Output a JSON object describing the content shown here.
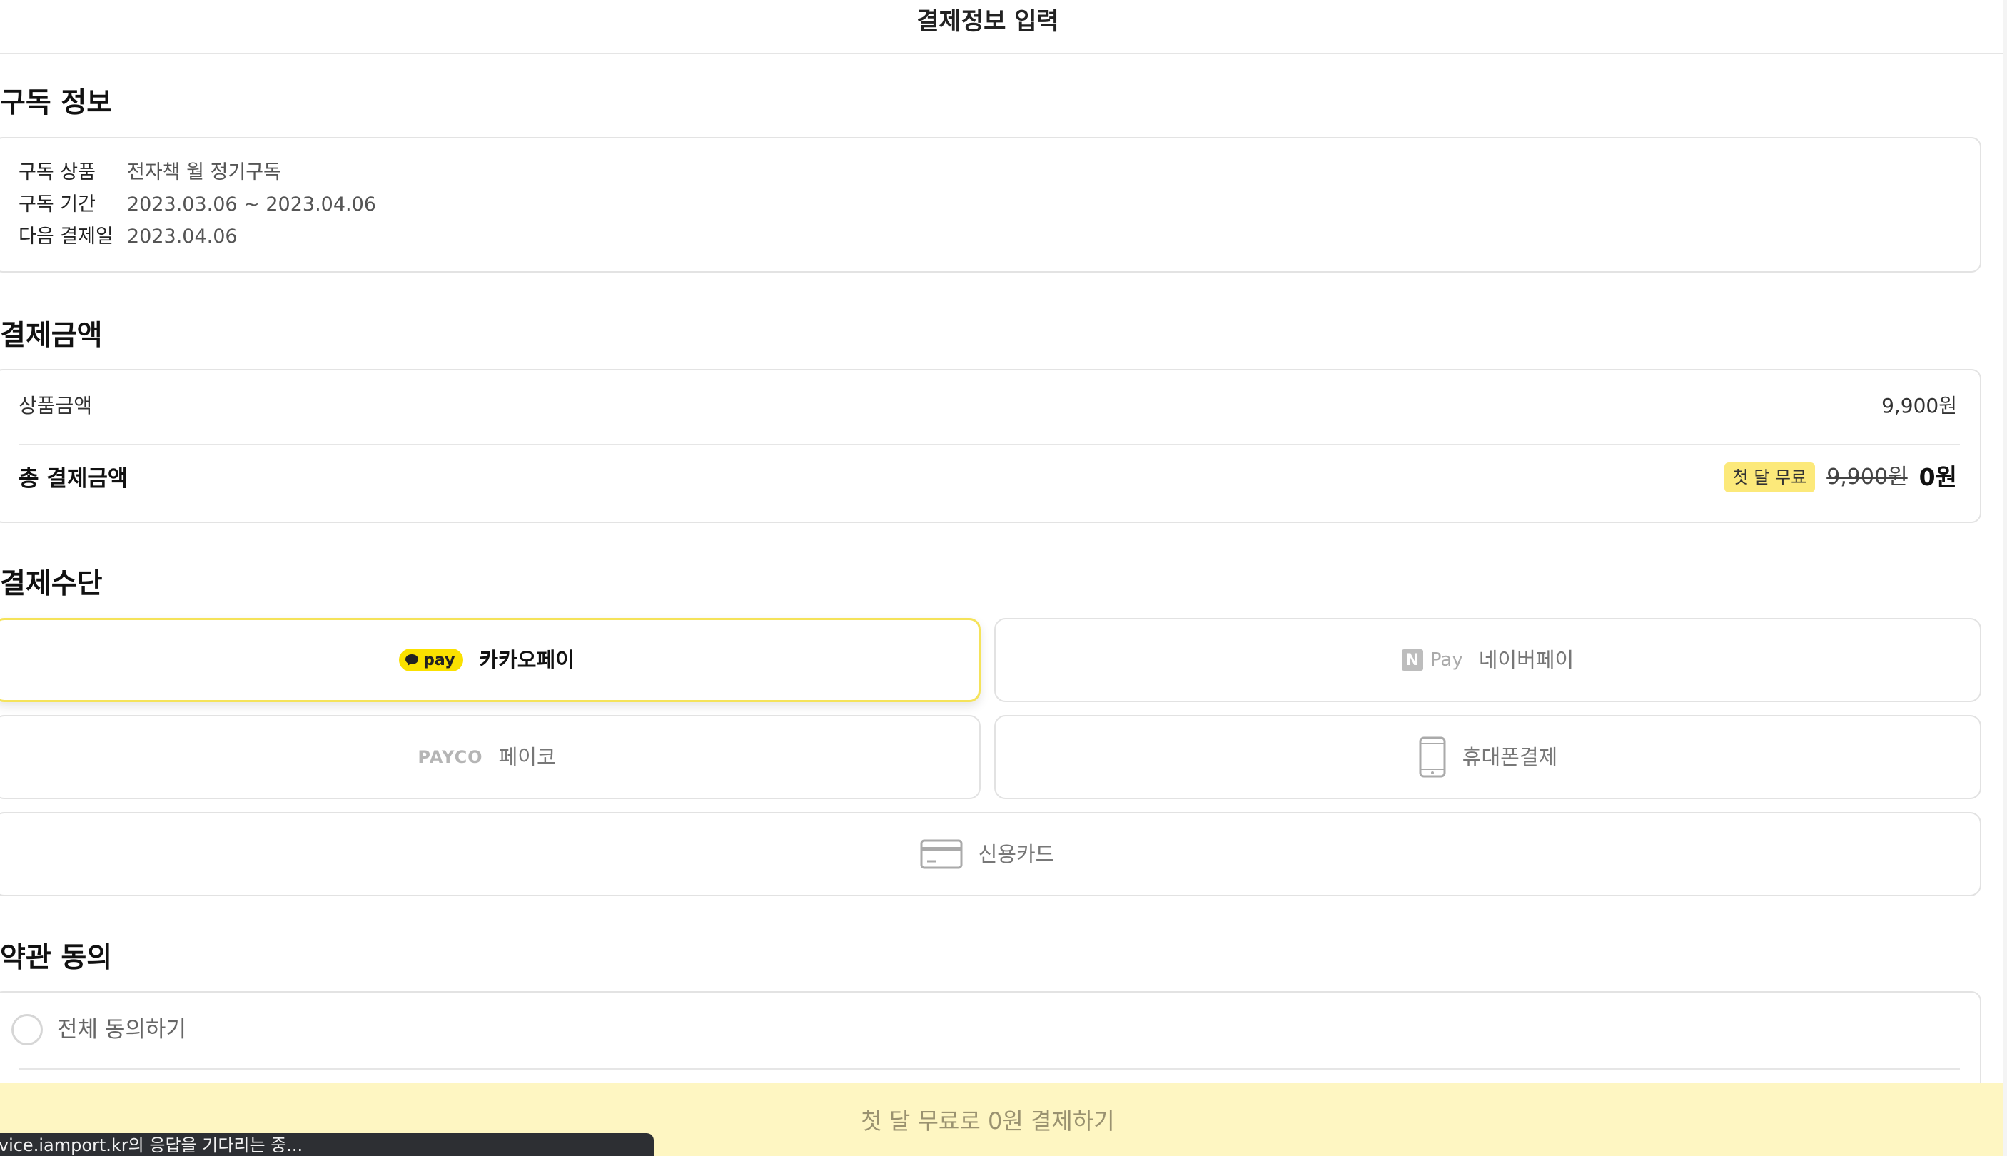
{
  "header": {
    "title": "결제정보 입력"
  },
  "subscription": {
    "section_title": "구독 정보",
    "rows": [
      {
        "label": "구독 상품",
        "value": "전자책 월 정기구독"
      },
      {
        "label": "구독 기간",
        "value": "2023.03.06 ~ 2023.04.06"
      },
      {
        "label": "다음 결제일",
        "value": "2023.04.06"
      }
    ]
  },
  "amount": {
    "section_title": "결제금액",
    "product_label": "상품금액",
    "product_value": "9,900원",
    "total_label": "총 결제금액",
    "promo_badge": "첫 달 무료",
    "original_price": "9,900원",
    "final_price": "0원",
    "badge_color": "#fce97a"
  },
  "payment": {
    "section_title": "결제수단",
    "methods": [
      {
        "id": "kakaopay",
        "label": "카카오페이",
        "logo_text": "pay",
        "icon": "kakao-pay-logo",
        "selected": true
      },
      {
        "id": "naverpay",
        "label": "네이버페이",
        "logo_text": "Pay",
        "logo_letter": "N",
        "icon": "naver-pay-logo",
        "selected": false
      },
      {
        "id": "payco",
        "label": "페이코",
        "logo_text": "PAYCO",
        "icon": "payco-logo",
        "selected": false
      },
      {
        "id": "phone",
        "label": "휴대폰결제",
        "icon": "mobile-phone-icon",
        "selected": false
      },
      {
        "id": "card",
        "label": "신용카드",
        "icon": "credit-card-icon",
        "selected": false
      }
    ],
    "selected_border_color": "#f5e35a",
    "kakao_color": "#fae100"
  },
  "terms": {
    "section_title": "약관 동의",
    "agree_all_label": "전체 동의하기"
  },
  "cta": {
    "label": "첫 달 무료로 0원 결제하기",
    "background": "#fef6c2"
  },
  "status": {
    "text": "rvice.iamport.kr의 응답을 기다리는 중..."
  }
}
